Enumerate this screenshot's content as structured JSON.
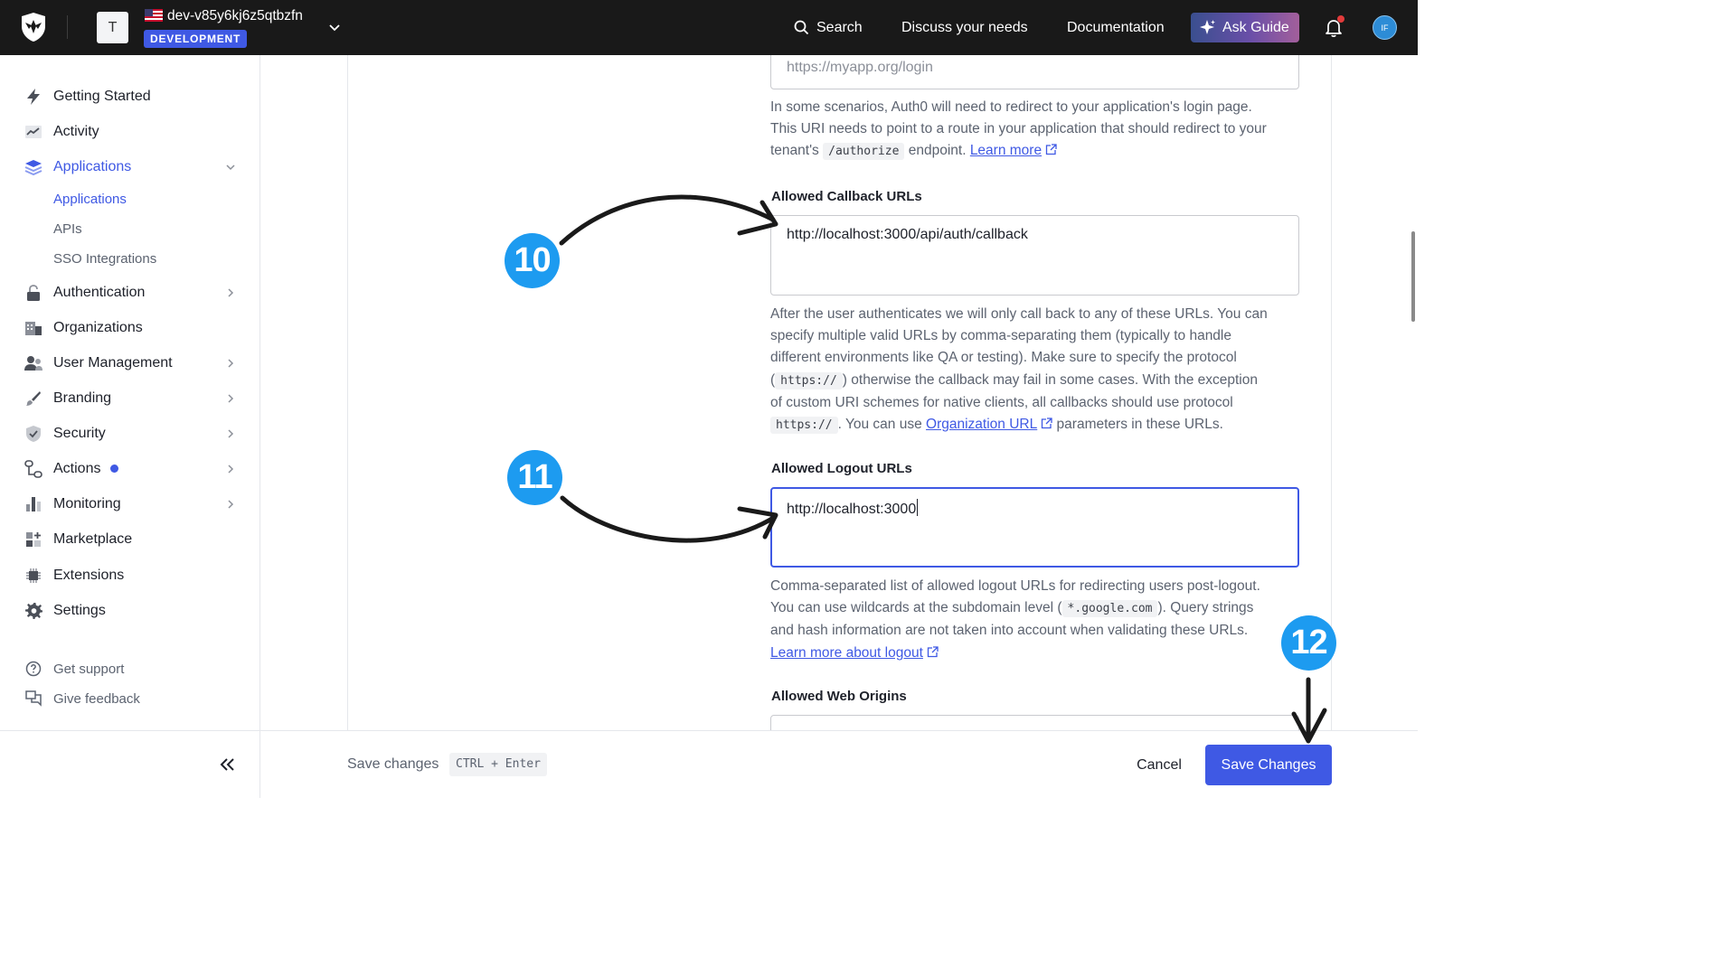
{
  "topbar": {
    "tenant_initial": "T",
    "tenant_name": "dev-v85y6kj6z5qtbzfn",
    "env_badge": "DEVELOPMENT",
    "search": "Search",
    "discuss": "Discuss your needs",
    "docs": "Documentation",
    "ask_guide": "Ask Guide",
    "user_initials": "IF"
  },
  "sidebar": {
    "items": [
      {
        "label": "Getting Started",
        "icon": "bolt-icon"
      },
      {
        "label": "Activity",
        "icon": "activity-chart-icon"
      },
      {
        "label": "Applications",
        "icon": "layers-icon"
      },
      {
        "label": "Authentication",
        "icon": "lock-icon"
      },
      {
        "label": "Organizations",
        "icon": "building-icon"
      },
      {
        "label": "User Management",
        "icon": "users-icon"
      },
      {
        "label": "Branding",
        "icon": "brush-icon"
      },
      {
        "label": "Security",
        "icon": "shield-icon"
      },
      {
        "label": "Actions",
        "icon": "flow-icon"
      },
      {
        "label": "Monitoring",
        "icon": "bar-chart-icon"
      },
      {
        "label": "Marketplace",
        "icon": "grid-plus-icon"
      },
      {
        "label": "Extensions",
        "icon": "chip-icon"
      },
      {
        "label": "Settings",
        "icon": "gear-icon"
      }
    ],
    "sub_items": [
      "Applications",
      "APIs",
      "SSO Integrations"
    ],
    "footer": [
      {
        "label": "Get support",
        "icon": "help-circle-icon"
      },
      {
        "label": "Give feedback",
        "icon": "feedback-icon"
      }
    ]
  },
  "form": {
    "login_uri_placeholder": "https://myapp.org/login",
    "login_help_1": "In some scenarios, Auth0 will need to redirect to your application's login page.",
    "login_help_2": "This URI needs to point to a route in your application that should redirect to your",
    "login_help_3a": "tenant's",
    "login_help_code": "/authorize",
    "login_help_3b": "endpoint.",
    "learn_more": "Learn more",
    "callback_label": "Allowed Callback URLs",
    "callback_value": "http://localhost:3000/api/auth/callback",
    "callback_help_1": "After the user authenticates we will only call back to any of these URLs. You can",
    "callback_help_2": "specify multiple valid URLs by comma-separating them (typically to handle",
    "callback_help_3": "different environments like QA or testing). Make sure to specify the protocol",
    "callback_help_4a": "(",
    "callback_help_code1": "https://",
    "callback_help_4b": ") otherwise the callback may fail in some cases. With the exception",
    "callback_help_5": "of custom URI schemes for native clients, all callbacks should use protocol",
    "callback_help_code2": "https://",
    "callback_help_6a": ". You can use",
    "callback_help_link": "Organization URL",
    "callback_help_6b": "parameters in these URLs.",
    "logout_label": "Allowed Logout URLs",
    "logout_value": "http://localhost:3000",
    "logout_help_1": "Comma-separated list of allowed logout URLs for redirecting users post-logout.",
    "logout_help_2a": "You can use wildcards at the subdomain level (",
    "logout_help_code": "*.google.com",
    "logout_help_2b": "). Query strings",
    "logout_help_3": "and hash information are not taken into account when validating these URLs.",
    "logout_learn_more": "Learn more about logout",
    "web_origins_label": "Allowed Web Origins"
  },
  "footer": {
    "save_hint": "Save changes",
    "shortcut": "CTRL + Enter",
    "cancel": "Cancel",
    "save": "Save Changes"
  },
  "annotations": {
    "step_10": "10",
    "step_11": "11",
    "step_12": "12"
  },
  "colors": {
    "accent": "#3f59e4",
    "badge": "#1d9bf0",
    "topbar": "#191919"
  }
}
